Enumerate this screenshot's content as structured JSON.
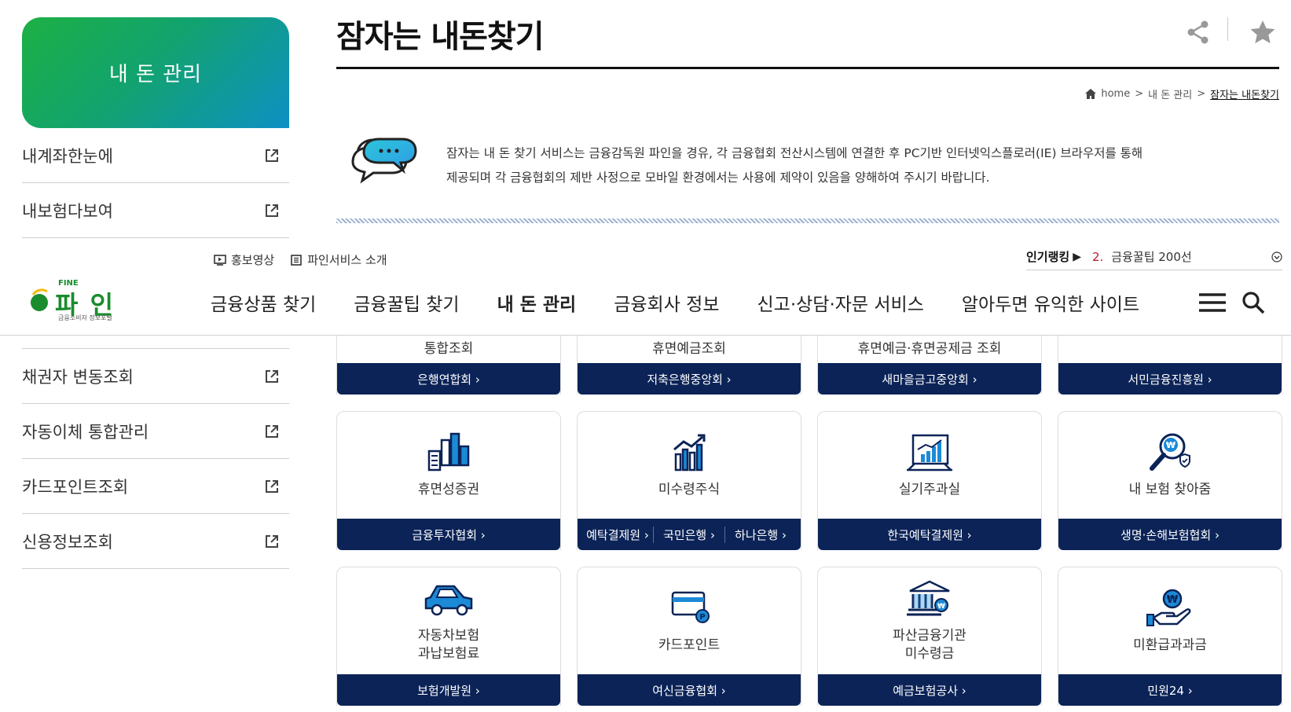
{
  "page": {
    "title": "잠자는 내돈찾기"
  },
  "sidebar": {
    "header": "내 돈 관리",
    "items_top": [
      {
        "label": "내계좌한눈에"
      },
      {
        "label": "내보험다보여"
      }
    ],
    "items_bottom": [
      {
        "label": "채권자 변동조회"
      },
      {
        "label": "자동이체 통합관리"
      },
      {
        "label": "카드포인트조회"
      },
      {
        "label": "신용정보조회"
      }
    ]
  },
  "breadcrumb": {
    "home": "home",
    "level1": "내 돈 관리",
    "current": "잠자는 내돈찾기",
    "sep": ">"
  },
  "notice": {
    "line1": "잠자는 내 돈 찾기 서비스는 금융감독원 파인을 경유, 각 금융협회 전산시스템에 연결한 후 PC기반 인터넷익스플로러(IE) 브라우저를 통해",
    "line2": "제공되며 각 금융협회의 제반 사정으로 모바일 환경에서는 사용에 제약이 있음을 양해하여 주시기 바랍니다."
  },
  "header": {
    "util": [
      "홍보영상",
      "파인서비스 소개"
    ],
    "ranking": {
      "label": "인기랭킹",
      "arrow": "▶",
      "number": "2.",
      "text": "금융꿀팁 200선"
    },
    "logo": {
      "brand_en": "FINE",
      "brand": "파 인",
      "sub": "금융소비자 정보포털"
    },
    "gnb": [
      {
        "label": "금융상품 찾기"
      },
      {
        "label": "금융꿀팁 찾기"
      },
      {
        "label": "내 돈 관리"
      },
      {
        "label": "금융회사 정보"
      },
      {
        "label": "신고·상담·자문 서비스"
      },
      {
        "label": "알아두면 유익한 사이트"
      }
    ]
  },
  "cards_top": [
    {
      "label": "통합조회",
      "button": "은행연합회 ›"
    },
    {
      "label": "휴면예금조회",
      "button": "저축은행중앙회 ›"
    },
    {
      "label": "휴면예금·휴면공제금 조회",
      "button": "새마을금고중앙회 ›"
    },
    {
      "label": "",
      "button": "서민금융진흥원 ›"
    }
  ],
  "cards_mid": [
    {
      "label": "휴면성증권",
      "icon": "building-chart-icon",
      "button": "금융투자협회 ›"
    },
    {
      "label": "미수령주식",
      "icon": "stock-growth-icon",
      "buttons": [
        "예탁결제원 ›",
        "국민은행 ›",
        "하나은행 ›"
      ]
    },
    {
      "label": "실기주과실",
      "icon": "board-chart-icon",
      "button": "한국예탁결제원 ›"
    },
    {
      "label": "내 보험 찾아줌",
      "icon": "magnifier-won-icon",
      "button": "생명·손해보험협회 ›"
    }
  ],
  "cards_bottom": [
    {
      "label": "자동차보험\n과납보험료",
      "icon": "car-icon",
      "button": "보험개발원 ›"
    },
    {
      "label": "카드포인트",
      "icon": "credit-card-icon",
      "button": "여신금융협회 ›"
    },
    {
      "label": "파산금융기관\n미수령금",
      "icon": "bank-icon",
      "button": "예금보험공사 ›"
    },
    {
      "label": "미환급과과금",
      "icon": "hand-coin-icon",
      "button": "민원24 ›"
    }
  ],
  "colors": {
    "navy": "#0b2357",
    "icon_blue": "#1c8ad6",
    "green": "#1db043",
    "accent_red": "#c8102e"
  }
}
